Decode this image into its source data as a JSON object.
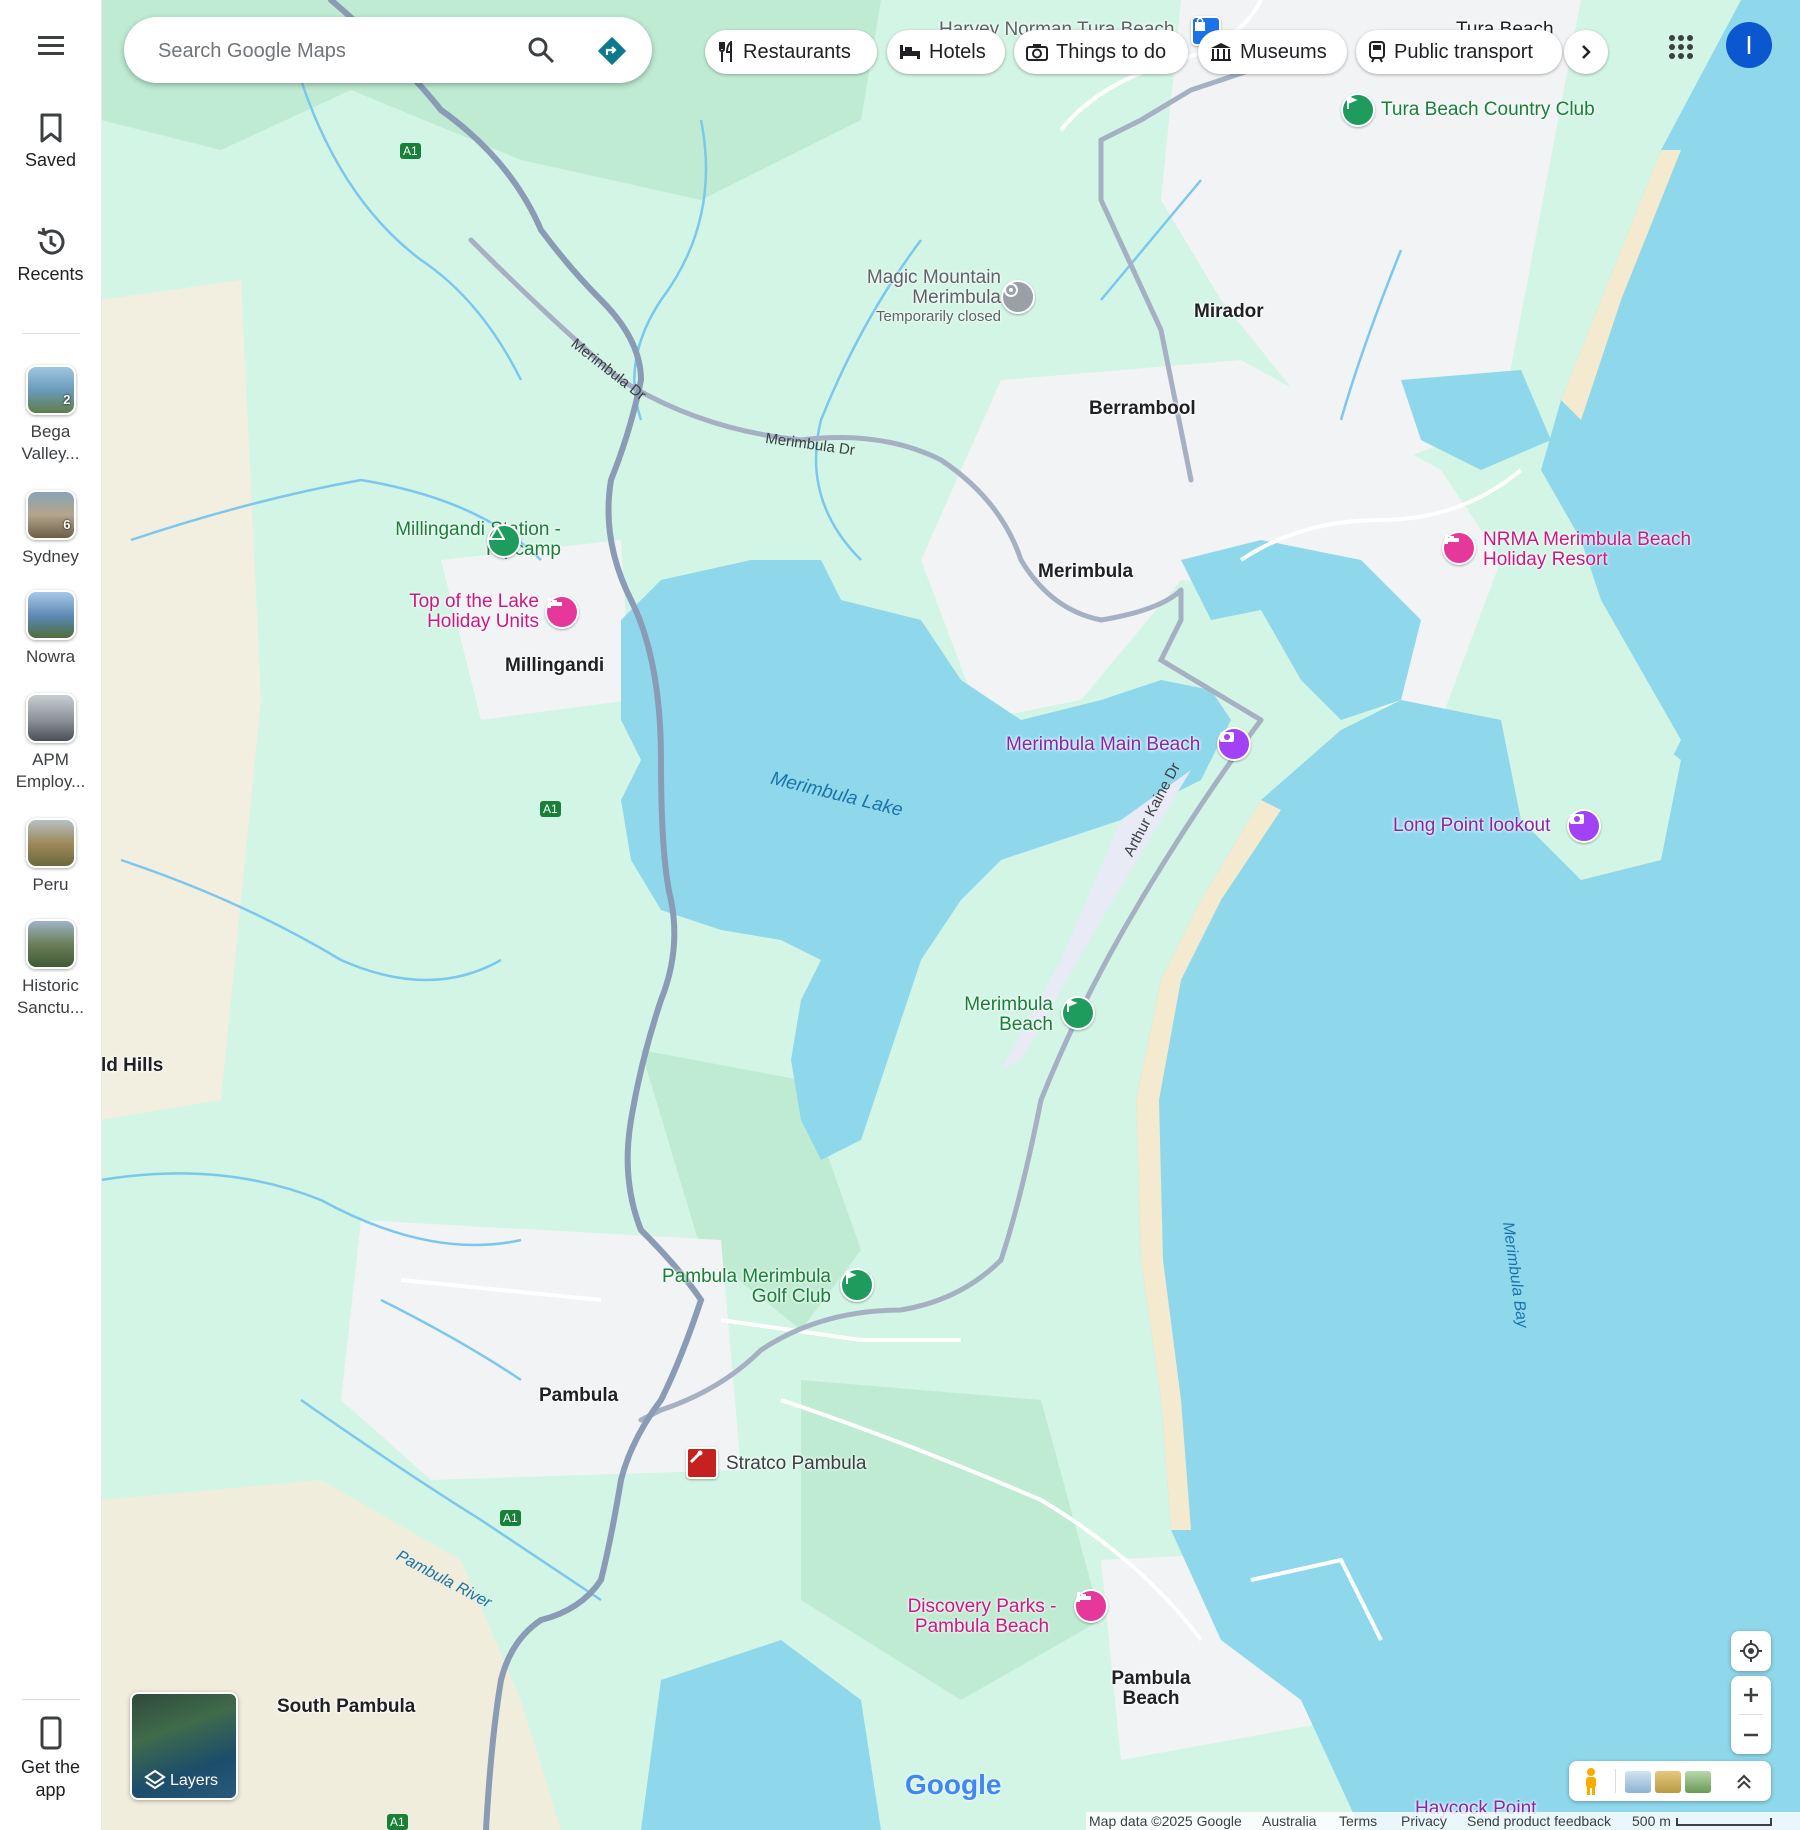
{
  "sidebar": {
    "saved_label": "Saved",
    "recents_label": "Recents",
    "get_app_label": "Get the app",
    "recent_places": [
      {
        "label": "Bega Valley...",
        "badge": "2"
      },
      {
        "label": "Sydney",
        "badge": "6"
      },
      {
        "label": "Nowra",
        "badge": ""
      },
      {
        "label": "APM Employ...",
        "badge": ""
      },
      {
        "label": "Peru",
        "badge": ""
      },
      {
        "label": "Historic Sanctu...",
        "badge": ""
      }
    ]
  },
  "search": {
    "placeholder": "Search Google Maps"
  },
  "chips": {
    "restaurants": "Restaurants",
    "hotels": "Hotels",
    "things_to_do": "Things to do",
    "museums": "Museums",
    "public_transport": "Public transport"
  },
  "account": {
    "initial": "I",
    "color": "#0b57d0"
  },
  "map": {
    "places": {
      "harvey_norman": "Harvey Norman Tura Beach",
      "tura_beach_top": "Tura Beach",
      "tura_beach_country_club": "Tura Beach Country Club",
      "magic_mountain": "Magic Mountain Merimbula",
      "magic_mountain_status": "Temporarily closed",
      "mirador": "Mirador",
      "berrambool": "Berrambool",
      "merimbula": "Merimbula",
      "nrma_resort": "NRMA Merimbula Beach Holiday Resort",
      "millingandi_station": "Millingandi Station - Hipcamp",
      "top_of_the_lake": "Top of the Lake Holiday Units",
      "millingandi": "Millingandi",
      "merimbula_main_beach": "Merimbula Main Beach",
      "long_point_lookout": "Long Point lookout",
      "merimbula_lake": "Merimbula Lake",
      "merimbula_beach": "Merimbula Beach",
      "ld_hills": "ld Hills",
      "merimbula_bay": "Merimbula Bay",
      "golf_club": "Pambula Merimbula Golf Club",
      "pambula": "Pambula",
      "stratco": "Stratco Pambula",
      "pambula_river": "Pambula River",
      "discovery_parks": "Discovery Parks - Pambula Beach",
      "pambula_beach": "Pambula Beach",
      "south_pambula": "South Pambula",
      "haycock_point": "Haycock Point"
    },
    "roads": {
      "merimbula_dr": "Merimbula Dr",
      "arthur_kaine_dr": "Arthur Kaine Dr",
      "a1": "A1"
    },
    "colors": {
      "water": "#8fd8ec",
      "land": "#d3f5e5",
      "urban": "#f1f3f4",
      "highway": "#8a9bb5",
      "road": "#ffffff",
      "beach": "#f3ead0",
      "hotel_pin": "#e6379a",
      "park_pin": "#1e9c5e",
      "attraction_pin": "#a142f4"
    }
  },
  "layers": {
    "label": "Layers"
  },
  "logo": {
    "text": "Google"
  },
  "footer": {
    "map_data": "Map data ©2025 Google",
    "country": "Australia",
    "terms": "Terms",
    "privacy": "Privacy",
    "feedback": "Send product feedback",
    "scale": "500 m"
  }
}
